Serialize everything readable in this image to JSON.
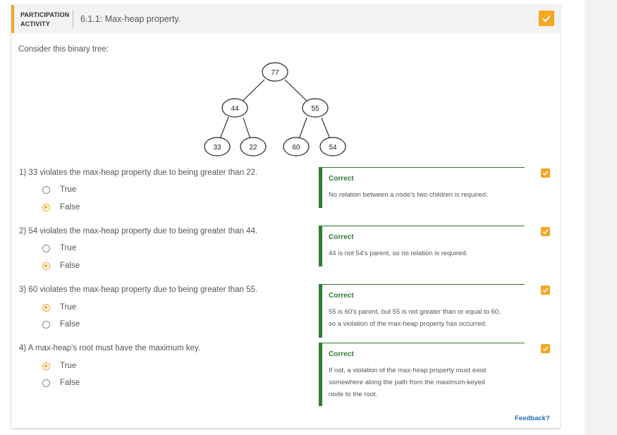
{
  "header": {
    "label": "PARTICIPATION ACTIVITY",
    "title": "6.1.1: Max-heap property.",
    "accent_color": "#f5a623",
    "complete_icon": "check-icon"
  },
  "prompt": "Consider this binary tree:",
  "tree": {
    "root": "77",
    "left": "44",
    "right": "55",
    "left_left": "33",
    "left_right": "22",
    "right_left": "60",
    "right_right": "54"
  },
  "questions": [
    {
      "text": "1) 33 violates the max-heap property due to being greater than 22.",
      "options": [
        "True",
        "False"
      ],
      "selected": "False",
      "feedback_title": "Correct",
      "feedback_lines": [
        "No relation between a node's two children is required."
      ]
    },
    {
      "text": "2) 54 violates the max-heap property due to being greater than 44.",
      "options": [
        "True",
        "False"
      ],
      "selected": "False",
      "feedback_title": "Correct",
      "feedback_lines": [
        "44 is not 54's parent, so no relation is required."
      ]
    },
    {
      "text": "3) 60 violates the max-heap property due to being greater than 55.",
      "options": [
        "True",
        "False"
      ],
      "selected": "True",
      "feedback_title": "Correct",
      "feedback_lines": [
        "55 is 60's parent, but 55 is not greater than or equal to 60,",
        "so a violation of the max-heap property has occurred."
      ]
    },
    {
      "text": "4) A max-heap's root must have the maximum key.",
      "options": [
        "True",
        "False"
      ],
      "selected": "True",
      "feedback_title": "Correct",
      "feedback_lines": [
        "If not, a violation of the max-heap property must exist",
        "somewhere along the path from the maximum-keyed",
        "node to the root."
      ]
    }
  ],
  "feedback_link": "Feedback?",
  "colors": {
    "correct": "#2e7d32",
    "link": "#1f6fb5",
    "selected_radio": "#f5a623"
  }
}
